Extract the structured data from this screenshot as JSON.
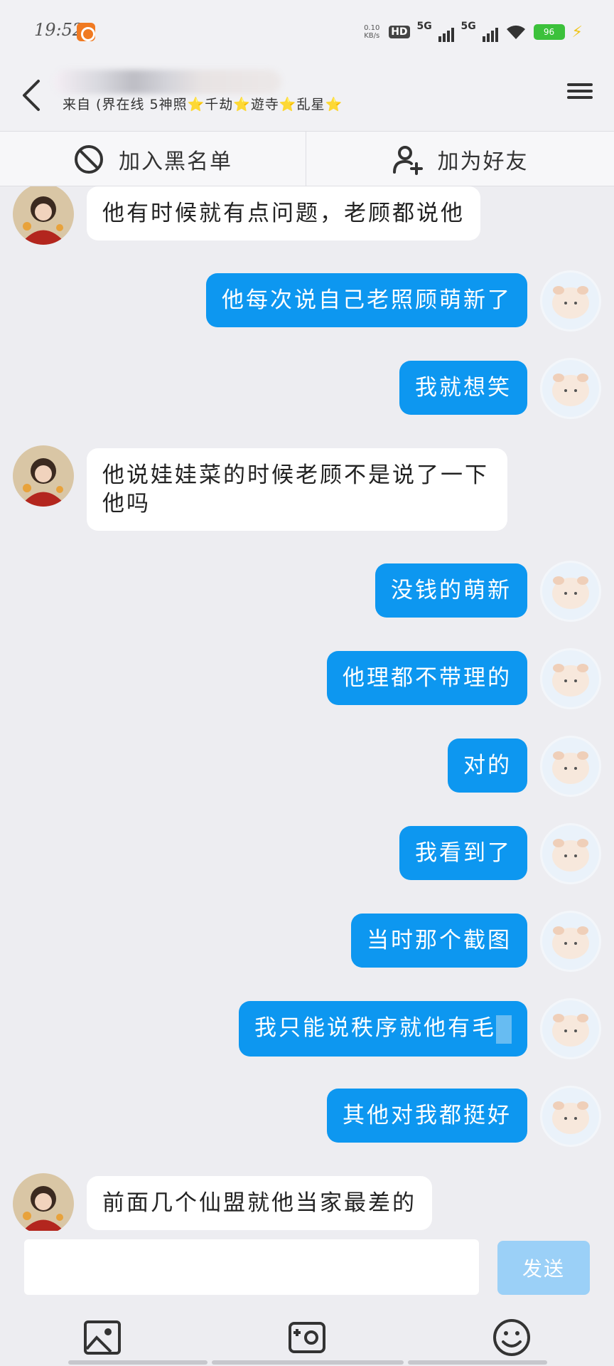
{
  "status_bar": {
    "time": "19:52",
    "net_speed_value": "0.10",
    "net_speed_unit": "KB/s",
    "hd_label": "HD",
    "sim1_label": "5G",
    "sim2_label": "5G",
    "battery": "96"
  },
  "header": {
    "subtitle": "来自 (界在线 5神照⭐千劫⭐遊寺⭐乱星⭐"
  },
  "actions": {
    "blacklist_label": "加入黑名单",
    "add_friend_label": "加为好友"
  },
  "messages": [
    {
      "side": "in",
      "text": "他有时候就有点问题，老顾都说他"
    },
    {
      "side": "out",
      "text": "他每次说自己老照顾萌新了"
    },
    {
      "side": "out",
      "text": "我就想笑"
    },
    {
      "side": "in",
      "text": "他说娃娃菜的时候老顾不是说了一下他吗"
    },
    {
      "side": "out",
      "text": "没钱的萌新"
    },
    {
      "side": "out",
      "text": "他理都不带理的"
    },
    {
      "side": "out",
      "text": "对的"
    },
    {
      "side": "out",
      "text": "我看到了"
    },
    {
      "side": "out",
      "text": "当时那个截图"
    },
    {
      "side": "out",
      "text": "我只能说秩序就他有毛"
    },
    {
      "side": "out",
      "text": "其他对我都挺好"
    },
    {
      "side": "in",
      "text": "前面几个仙盟就他当家最差的"
    }
  ],
  "input": {
    "value": "",
    "send_label": "发送"
  },
  "colors": {
    "accent_blue": "#0d97f0",
    "send_disabled": "#9bd0f7",
    "background": "#ededf1"
  }
}
